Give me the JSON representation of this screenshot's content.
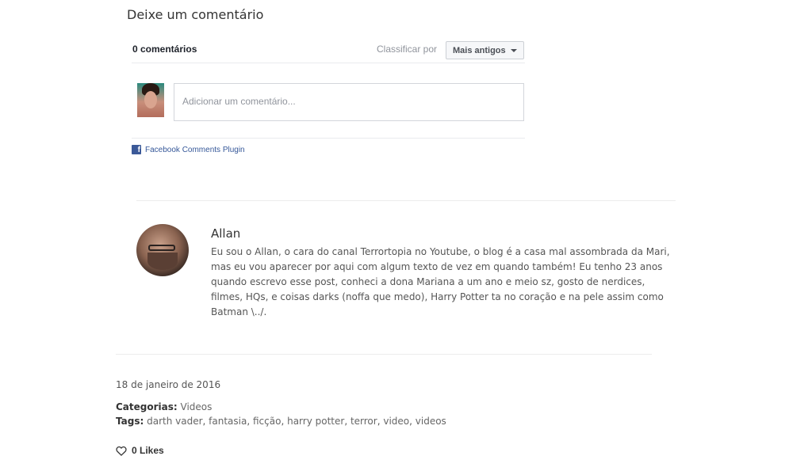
{
  "section_title": "Deixe um comentário",
  "fb_comments": {
    "count_label": "0 comentários",
    "sort_label": "Classificar por",
    "sort_selected": "Mais antigos",
    "input_placeholder": "Adicionar um comentário...",
    "plugin_label": "Facebook Comments Plugin",
    "plugin_icon": "facebook-icon"
  },
  "author": {
    "name": "Allan",
    "bio": "Eu sou o Allan, o cara do canal Terrortopia no Youtube, o blog é a casa mal assombrada da Mari, mas eu vou aparecer por aqui com algum texto de vez em quando também! Eu tenho 23 anos quando escrevo esse post, conheci a dona Mariana a um ano e meio sz, gosto de nerdices, filmes, HQs, e coisas darks (noffa que medo), Harry Potter ta no coração e na pele assim como Batman \\../."
  },
  "post_meta": {
    "date": "18 de janeiro de 2016",
    "categories_label": "Categorias:",
    "categories": [
      "Videos"
    ],
    "tags_label": "Tags:",
    "tags": [
      "darth vader",
      "fantasia",
      "ficção",
      "harry potter",
      "terror",
      "video",
      "videos"
    ]
  },
  "likes": {
    "icon": "heart-icon",
    "label": "0 Likes"
  },
  "colors": {
    "facebook_blue": "#3b5998",
    "link_blue": "#365899"
  }
}
